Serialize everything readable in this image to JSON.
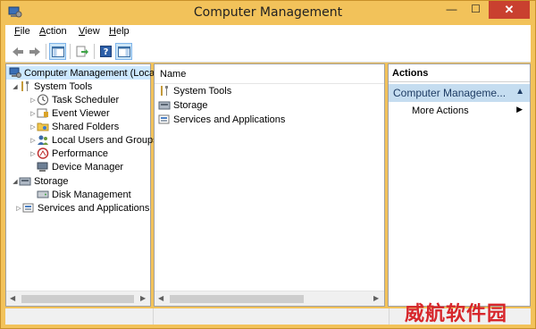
{
  "window": {
    "title": "Computer Management",
    "buttons": {
      "minimize": "—",
      "maximize": "☐",
      "close": "✕"
    }
  },
  "menu": [
    {
      "label": "File",
      "key": "F",
      "rest": "ile"
    },
    {
      "label": "Action",
      "key": "A",
      "rest": "ction"
    },
    {
      "label": "View",
      "key": "V",
      "rest": "iew"
    },
    {
      "label": "Help",
      "key": "H",
      "rest": "elp"
    }
  ],
  "toolbar": {
    "icons": [
      "back-arrow-icon",
      "forward-arrow-icon",
      "show-hide-console-tree-icon",
      "export-list-icon",
      "help-icon",
      "show-hide-action-pane-icon"
    ]
  },
  "tree": {
    "root": "Computer Management (Local",
    "system_tools": "System Tools",
    "task_scheduler": "Task Scheduler",
    "event_viewer": "Event Viewer",
    "shared_folders": "Shared Folders",
    "local_users": "Local Users and Groups",
    "performance": "Performance",
    "device_manager": "Device Manager",
    "storage": "Storage",
    "disk_management": "Disk Management",
    "services_apps": "Services and Applications"
  },
  "list": {
    "column_name": "Name",
    "items": [
      "System Tools",
      "Storage",
      "Services and Applications"
    ]
  },
  "actions": {
    "header": "Actions",
    "section": "Computer Manageme...",
    "more_actions": "More Actions"
  },
  "watermark": "威航软件园",
  "colors": {
    "title_bar": "#f2c25a",
    "close_button": "#c9402f",
    "selection": "#cce8ff",
    "actions_section": "#c5ddf0",
    "watermark": "#d7262b"
  }
}
